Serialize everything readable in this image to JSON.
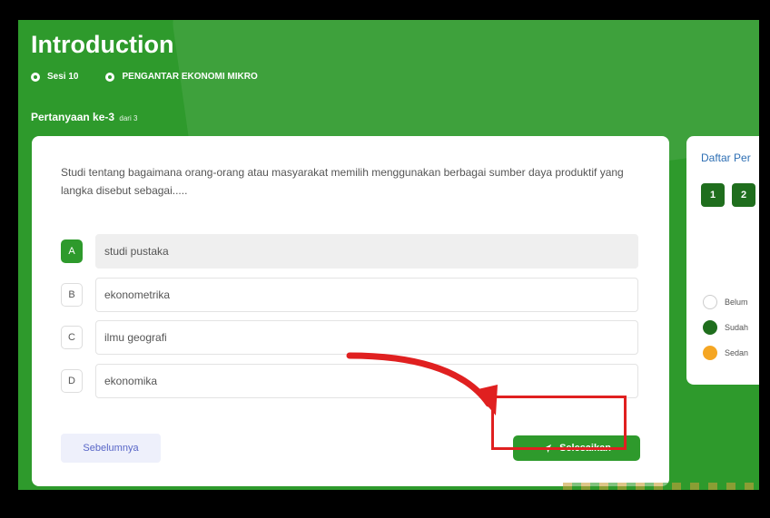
{
  "page": {
    "title": "Introduction",
    "session": "Sesi 10",
    "course": "PENGANTAR EKONOMI MIKRO",
    "question_label": "Pertanyaan ke-3",
    "question_of": "dari 3"
  },
  "question": {
    "text": "Studi tentang bagaimana orang-orang atau masyarakat memilih menggunakan berbagai sumber daya produktif yang langka disebut sebagai.....",
    "options": [
      {
        "letter": "A",
        "text": "studi pustaka",
        "selected": true
      },
      {
        "letter": "B",
        "text": "ekonometrika",
        "selected": false
      },
      {
        "letter": "C",
        "text": "ilmu geografi",
        "selected": false
      },
      {
        "letter": "D",
        "text": "ekonomika",
        "selected": false
      }
    ]
  },
  "nav": {
    "prev_label": "Sebelumnya",
    "finish_label": "Selesaikan"
  },
  "sidebar": {
    "title": "Daftar Per",
    "numbers": [
      "1",
      "2"
    ],
    "legend": [
      "Belum",
      "Sudah",
      "Sedan"
    ]
  },
  "colors": {
    "primary": "#2e9a2c",
    "dark_green": "#1f6e1d",
    "annotation_red": "#e02020",
    "in_progress": "#f5a623"
  }
}
